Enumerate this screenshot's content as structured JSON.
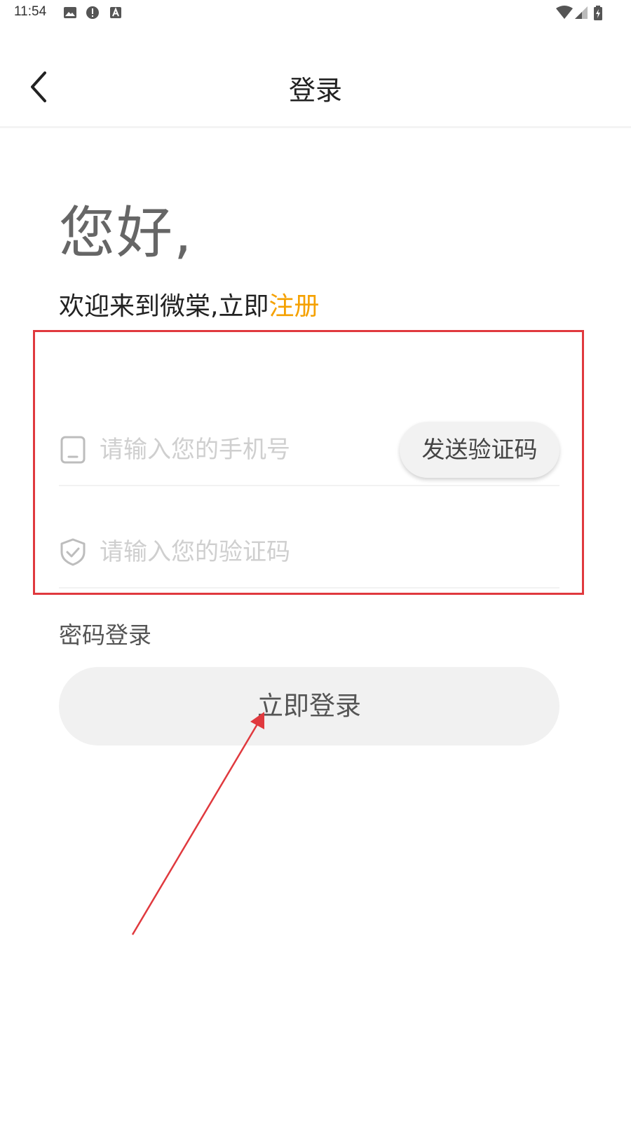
{
  "status_bar": {
    "time": "11:54",
    "left_icons": [
      "image-icon",
      "alert-icon",
      "a-icon"
    ],
    "right_icons": [
      "wifi-icon",
      "signal-icon",
      "battery-icon"
    ]
  },
  "header": {
    "title": "登录",
    "back_icon": "chevron-left-icon"
  },
  "greeting": "您好,",
  "welcome": {
    "prefix": "欢迎来到微棠,立即",
    "register_link": "注册",
    "link_color": "#f5a100"
  },
  "form": {
    "phone": {
      "icon": "phone-icon",
      "value": "",
      "placeholder": "请输入您的手机号"
    },
    "send_code_label": "发送验证码",
    "code": {
      "icon": "shield-check-icon",
      "value": "",
      "placeholder": "请输入您的验证码"
    }
  },
  "password_login_label": "密码登录",
  "login_button_label": "立即登录",
  "annotation": {
    "color": "#e0393e"
  }
}
